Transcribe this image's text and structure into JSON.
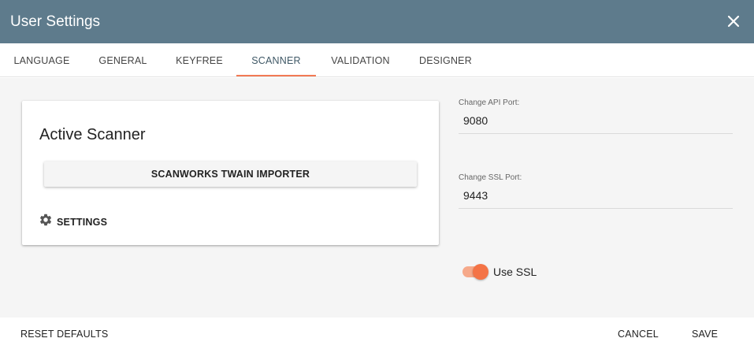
{
  "dialog": {
    "title": "User Settings"
  },
  "tabs": [
    {
      "label": "LANGUAGE"
    },
    {
      "label": "GENERAL"
    },
    {
      "label": "KEYFREE"
    },
    {
      "label": "SCANNER",
      "active": true
    },
    {
      "label": "VALIDATION"
    },
    {
      "label": "DESIGNER"
    }
  ],
  "scanner_card": {
    "title": "Active Scanner",
    "scanner_button": "SCANWORKS TWAIN IMPORTER",
    "settings_label": "SETTINGS",
    "settings_icon": "gear-icon"
  },
  "api_port": {
    "label": "Change API Port:",
    "value": "9080"
  },
  "ssl_port": {
    "label": "Change SSL Port:",
    "value": "9443"
  },
  "ssl_toggle": {
    "label": "Use SSL",
    "checked": true
  },
  "footer": {
    "reset_label": "RESET DEFAULTS",
    "cancel_label": "CANCEL",
    "save_label": "SAVE"
  },
  "colors": {
    "header": "#5e7b8c",
    "accent": "#f47346",
    "active_tab_text": "#3f5866"
  }
}
